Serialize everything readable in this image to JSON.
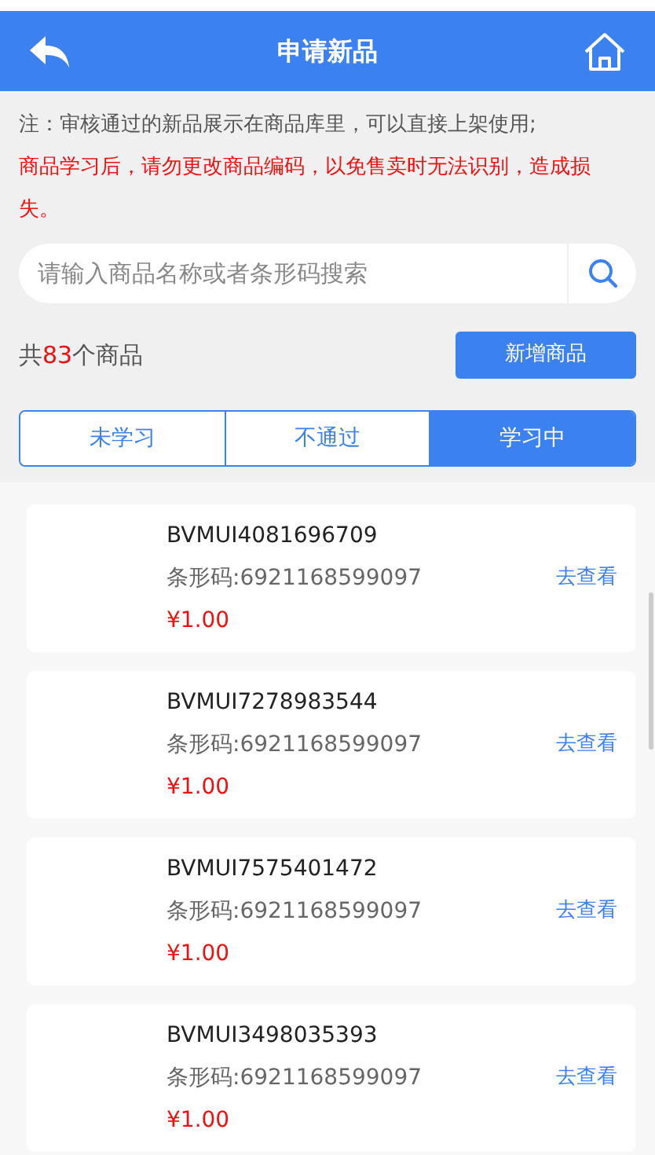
{
  "header": {
    "title": "申请新品"
  },
  "notes": [
    {
      "kind": "info",
      "text": "注：审核通过的新品展示在商品库里，可以直接上架使用;"
    },
    {
      "kind": "warning",
      "text": "商品学习后，请勿更改商品编码，以免售卖时无法识别，造成损失。"
    }
  ],
  "search": {
    "placeholder": "请输入商品名称或者条形码搜索"
  },
  "summary": {
    "prefix": "共",
    "count": "83",
    "suffix": "个商品"
  },
  "add_button": "新增商品",
  "tabs": [
    {
      "label": "未学习",
      "selected": false
    },
    {
      "label": "不通过",
      "selected": false
    },
    {
      "label": "学习中",
      "selected": true
    }
  ],
  "products": [
    {
      "name": "BVMUI4081696709",
      "barcode": "条形码:6921168599097",
      "price": "¥1.00",
      "action": "去查看"
    },
    {
      "name": "BVMUI7278983544",
      "barcode": "条形码:6921168599097",
      "price": "¥1.00",
      "action": "去查看"
    },
    {
      "name": "BVMUI7575401472",
      "barcode": "条形码:6921168599097",
      "price": "¥1.00",
      "action": "去查看"
    },
    {
      "name": "BVMUI3498035393",
      "barcode": "条形码:6921168599097",
      "price": "¥1.00",
      "action": "去查看"
    }
  ]
}
